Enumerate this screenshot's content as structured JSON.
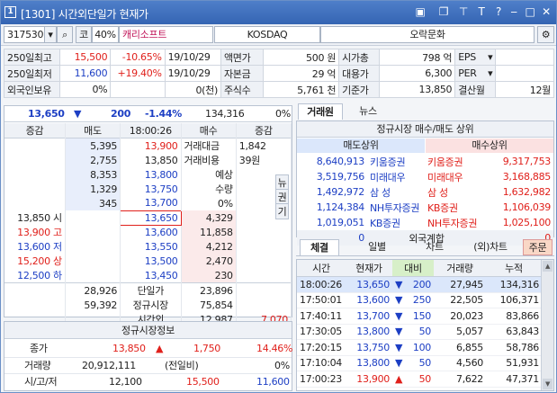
{
  "title": {
    "screen_no": "[1301]",
    "title": "시간외단일가 현재가",
    "icons": [
      "window-icon",
      "restore-icon",
      "pin-icon",
      "font-icon",
      "help-icon",
      "close-icon"
    ]
  },
  "toolbar": {
    "code": "317530",
    "kospi_label": "코",
    "margin": "40%",
    "name": "캐리소프트",
    "market": "KOSDAQ",
    "sector": "오락문화"
  },
  "info": [
    [
      "250일최고",
      "15,500",
      "-10.65%",
      "19/10/29",
      "액면가",
      "500 원",
      "시가총",
      "798 억",
      "EPS",
      ""
    ],
    [
      "250일최저",
      "11,600",
      "+19.40%",
      "19/10/29",
      "자본금",
      "29 억",
      "대용가",
      "6,300",
      "PER",
      ""
    ],
    [
      "외국인보유",
      "0%",
      "",
      "0(천)",
      "주식수",
      "5,761 천",
      "기준가",
      "13,850",
      "결산월",
      "12월"
    ]
  ],
  "summary": {
    "price": "13,650",
    "arrow": "▼",
    "change": "200",
    "rate": "-1.44%",
    "volume": "134,316",
    "pct": "0%"
  },
  "hoga_header": [
    "증감",
    "매도",
    "18:00:26",
    "매수",
    "증감"
  ],
  "asks": [
    {
      "qty": "5,395",
      "price": "13,900"
    },
    {
      "qty": "2,755",
      "price": "13,850"
    },
    {
      "qty": "8,353",
      "price": "13,800"
    },
    {
      "qty": "1,329",
      "price": "13,750"
    },
    {
      "qty": "345",
      "price": "13,700"
    }
  ],
  "ask_side": {
    "l1": "거래대금",
    "v1": "1,842",
    "l2": "거래비용",
    "v2": "39원",
    "l3": "예상",
    "l4": "수량",
    "v4": "0%",
    "b1": "뉴",
    "b2": "권",
    "b3": "기"
  },
  "bids": [
    {
      "qty": "4,329",
      "price": "13,650"
    },
    {
      "qty": "11,858",
      "price": "13,600"
    },
    {
      "qty": "4,212",
      "price": "13,550"
    },
    {
      "qty": "2,470",
      "price": "13,500"
    },
    {
      "qty": "230",
      "price": "13,450"
    }
  ],
  "bid_side": [
    {
      "v": "13,850",
      "l": "시"
    },
    {
      "v": "13,900",
      "l": "고"
    },
    {
      "v": "13,600",
      "l": "저"
    },
    {
      "v": "15,200",
      "l": "상"
    },
    {
      "v": "12,500",
      "l": "하"
    }
  ],
  "totals": [
    {
      "left": "28,926",
      "label": "단일가",
      "right": "23,896"
    },
    {
      "left": "59,392",
      "label": "정규시장",
      "right": "75,854"
    },
    {
      "left": "",
      "label": "시간외",
      "right": "12,987",
      "extra": "7,070"
    }
  ],
  "regular": {
    "title": "정규시장정보",
    "row1": {
      "l": "종가",
      "price": "13,850",
      "arrow": "▲",
      "chg": "1,750",
      "rate": "14.46%"
    },
    "row2": {
      "l": "거래량",
      "v": "20,912,111",
      "m": "(전일비)",
      "pct": "0%"
    },
    "row3": {
      "l": "시/고/저",
      "a": "12,100",
      "b": "15,500",
      "c": "11,600"
    }
  },
  "right_tabs": {
    "t1": "거래원",
    "t2": "뉴스"
  },
  "broker": {
    "title": "정규시장 매수/매도 상위",
    "h1": "매도상위",
    "h2": "매수상위",
    "rows": [
      [
        "8,640,913",
        "키움증권",
        "키움증권",
        "9,317,753"
      ],
      [
        "3,519,756",
        "미래대우",
        "미래대우",
        "3,168,885"
      ],
      [
        "1,492,972",
        "삼 성",
        "삼 성",
        "1,632,982"
      ],
      [
        "1,124,384",
        "NH투자증권",
        "KB증권",
        "1,106,039"
      ],
      [
        "1,019,051",
        "KB증권",
        "NH투자증권",
        "1,025,100"
      ]
    ],
    "foreign": {
      "l": "0",
      "label": "외국계합",
      "r": "0"
    }
  },
  "bottom_tabs": [
    "체결",
    "일별",
    "차트",
    "(외)차트",
    "주문"
  ],
  "ticks_header": [
    "시간",
    "현재가",
    "대비",
    "거래량",
    "누적"
  ],
  "ticks": [
    {
      "t": "18:00:26",
      "p": "13,650",
      "a": "▼",
      "c": "200",
      "v": "27,945",
      "s": "134,316",
      "pc": "b"
    },
    {
      "t": "17:50:01",
      "p": "13,600",
      "a": "▼",
      "c": "250",
      "v": "22,505",
      "s": "106,371",
      "pc": "b"
    },
    {
      "t": "17:40:11",
      "p": "13,700",
      "a": "▼",
      "c": "150",
      "v": "20,023",
      "s": "83,866",
      "pc": "b"
    },
    {
      "t": "17:30:05",
      "p": "13,800",
      "a": "▼",
      "c": "50",
      "v": "5,057",
      "s": "63,843",
      "pc": "b"
    },
    {
      "t": "17:20:15",
      "p": "13,750",
      "a": "▼",
      "c": "100",
      "v": "6,855",
      "s": "58,786",
      "pc": "b"
    },
    {
      "t": "17:10:04",
      "p": "13,800",
      "a": "▼",
      "c": "50",
      "v": "4,560",
      "s": "51,931",
      "pc": "b"
    },
    {
      "t": "17:00:23",
      "p": "13,900",
      "a": "▲",
      "c": "50",
      "v": "7,622",
      "s": "47,371",
      "pc": "r"
    }
  ]
}
